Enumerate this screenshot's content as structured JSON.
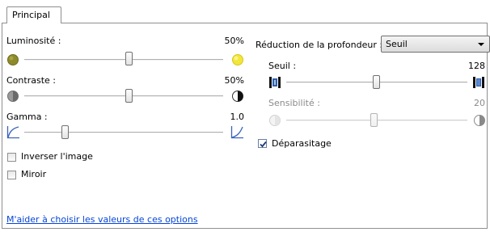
{
  "tabs": [
    {
      "label": "Principal"
    }
  ],
  "brightness": {
    "label": "Luminosité :",
    "value": "50%",
    "level": 0.5
  },
  "contrast": {
    "label": "Contraste :",
    "value": "50%",
    "level": 0.5
  },
  "gamma": {
    "label": "Gamma :",
    "value": "1.0",
    "level": 0.2
  },
  "invert": {
    "label": "Inverser l'image",
    "checked": false
  },
  "mirror": {
    "label": "Miroir",
    "checked": false
  },
  "depth_reduction": {
    "label": "Réduction de la profondeur :",
    "selected": "Seuil"
  },
  "threshold": {
    "label": "Seuil :",
    "value": "128",
    "level": 0.5
  },
  "sensitivity": {
    "label": "Sensibilité :",
    "value": "20",
    "level": 0.5,
    "enabled": false
  },
  "despeckle": {
    "label": "Déparasitage",
    "checked": true
  },
  "help_link": "M'aider à choisir les valeurs de ces options",
  "colors": {
    "brightness_dark": "#8d8a2c",
    "brightness_light": "#f2e63a",
    "link": "#0645d8",
    "threshold_icon": "#2f5fa8"
  },
  "icons": {
    "brightness_low": "dim-sun-icon",
    "brightness_high": "bright-sun-icon",
    "contrast_low": "low-contrast-icon",
    "contrast_high": "high-contrast-icon",
    "gamma_low": "gamma-curve-low-icon",
    "gamma_high": "gamma-curve-high-icon",
    "threshold_low": "threshold-low-icon",
    "threshold_high": "threshold-high-icon",
    "sensitivity_low": "sensitivity-low-icon",
    "sensitivity_high": "sensitivity-high-icon",
    "dropdown": "chevron-down-icon"
  }
}
